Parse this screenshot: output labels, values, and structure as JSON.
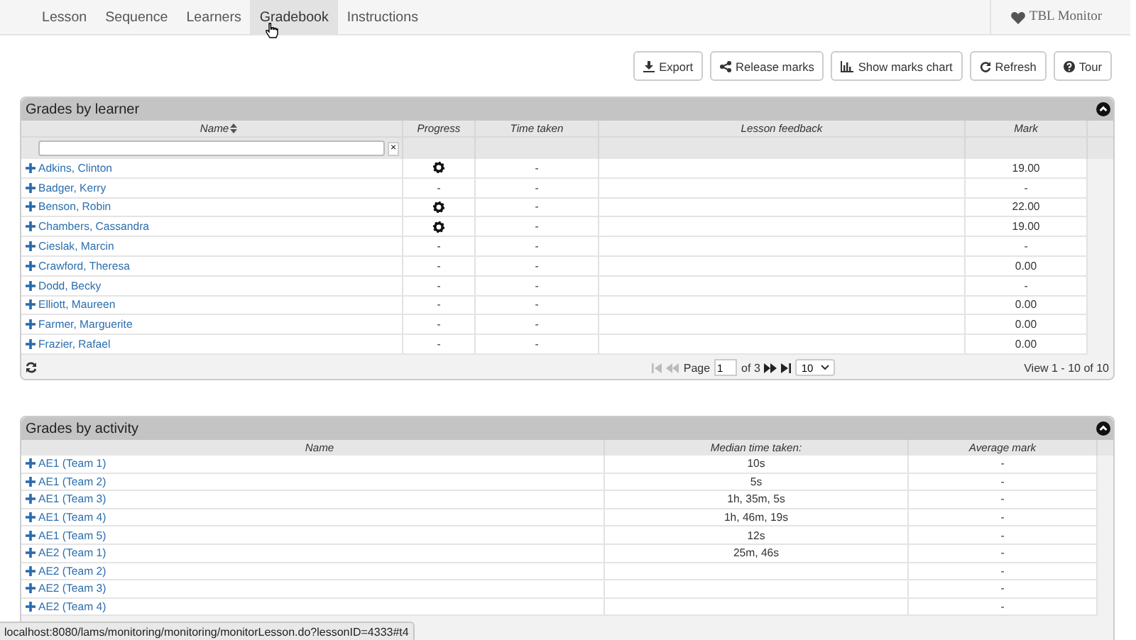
{
  "nav": {
    "tabs": [
      {
        "label": "Lesson",
        "selected": false
      },
      {
        "label": "Sequence",
        "selected": false
      },
      {
        "label": "Learners",
        "selected": false
      },
      {
        "label": "Gradebook",
        "selected": true
      },
      {
        "label": "Instructions",
        "selected": false
      }
    ],
    "brand": "TBL Monitor"
  },
  "toolbar": {
    "buttons": [
      {
        "label": "Export",
        "kind": "export"
      },
      {
        "label": "Release marks",
        "kind": "share"
      },
      {
        "label": "Show marks chart",
        "kind": "chart"
      },
      {
        "label": "Refresh",
        "kind": "refresh"
      },
      {
        "label": "Tour",
        "kind": "help"
      }
    ]
  },
  "learners": {
    "title": "Grades by learner",
    "columns": [
      "Name",
      "Progress",
      "Time taken",
      "Lesson feedback",
      "Mark"
    ],
    "filter_clear": "×",
    "rows": [
      {
        "name": "Adkins, Clinton",
        "progress": {
          "kind": "gear"
        },
        "time": "-",
        "mark": "19.00"
      },
      {
        "name": "Badger, Kerry",
        "progress": {
          "kind": "text",
          "text": "-"
        },
        "time": "-",
        "mark": "-"
      },
      {
        "name": "Benson, Robin",
        "progress": {
          "kind": "gear"
        },
        "time": "-",
        "mark": "22.00"
      },
      {
        "name": "Chambers, Cassandra",
        "progress": {
          "kind": "gear"
        },
        "time": "-",
        "mark": "19.00"
      },
      {
        "name": "Cieslak, Marcin",
        "progress": {
          "kind": "text",
          "text": "-"
        },
        "time": "-",
        "mark": "-"
      },
      {
        "name": "Crawford, Theresa",
        "progress": {
          "kind": "text",
          "text": "-"
        },
        "time": "-",
        "mark": "0.00"
      },
      {
        "name": "Dodd, Becky",
        "progress": {
          "kind": "text",
          "text": "-"
        },
        "time": "-",
        "mark": "-"
      },
      {
        "name": "Elliott, Maureen",
        "progress": {
          "kind": "text",
          "text": "-"
        },
        "time": "-",
        "mark": "0.00"
      },
      {
        "name": "Farmer, Marguerite",
        "progress": {
          "kind": "text",
          "text": "-"
        },
        "time": "-",
        "mark": "0.00"
      },
      {
        "name": "Frazier, Rafael",
        "progress": {
          "kind": "text",
          "text": "-"
        },
        "time": "-",
        "mark": "0.00"
      }
    ],
    "pager": {
      "page_label": "Page",
      "page": "1",
      "of": "of 3",
      "page_size": "10",
      "view": "View 1 - 10 of 10"
    }
  },
  "activities": {
    "title": "Grades by activity",
    "columns": [
      "Name",
      "Median time taken:",
      "Average mark"
    ],
    "rows": [
      {
        "name": "AE1 (Team 1)",
        "median": "10s",
        "average": "-"
      },
      {
        "name": "AE1 (Team 2)",
        "median": "5s",
        "average": "-"
      },
      {
        "name": "AE1 (Team 3)",
        "median": "1h, 35m, 5s",
        "average": "-"
      },
      {
        "name": "AE1 (Team 4)",
        "median": "1h, 46m, 19s",
        "average": "-"
      },
      {
        "name": "AE1 (Team 5)",
        "median": "12s",
        "average": "-"
      },
      {
        "name": "AE2 (Team 1)",
        "median": "25m, 46s",
        "average": "-"
      },
      {
        "name": "AE2 (Team 2)",
        "median": "",
        "average": "-"
      },
      {
        "name": "AE2 (Team 3)",
        "median": "",
        "average": "-"
      },
      {
        "name": "AE2 (Team 4)",
        "median": "",
        "average": "-"
      }
    ]
  },
  "status_bar": "localhost:8080/lams/monitoring/monitoring/monitorLesson.do?lessonID=4333#t4"
}
